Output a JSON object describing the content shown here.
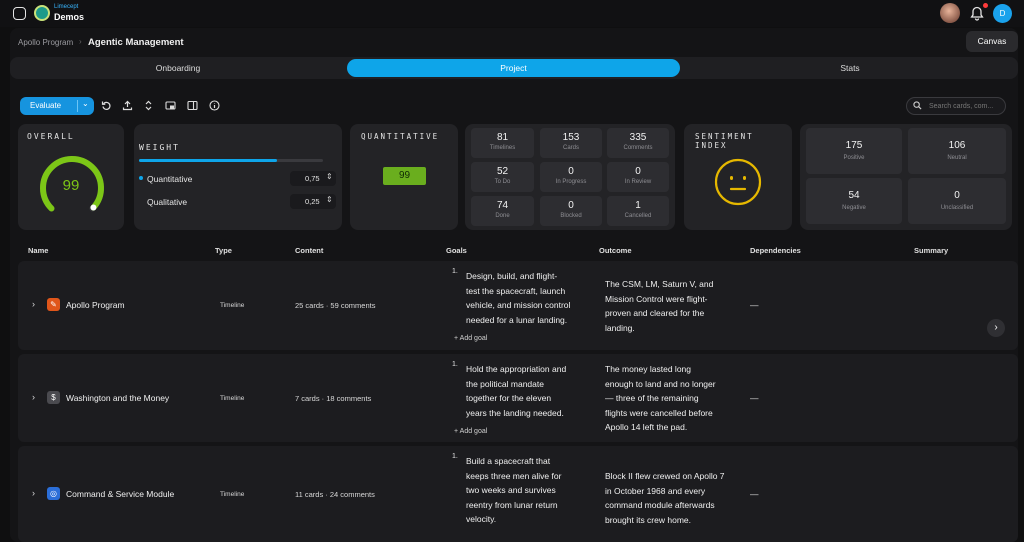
{
  "brand": {
    "sub": "Limecept",
    "name": "Demos"
  },
  "user": {
    "initial": "D"
  },
  "breadcrumb": {
    "parent": "Apollo Program",
    "current": "Agentic Management"
  },
  "canvas_label": "Canvas",
  "tabs": [
    {
      "label": "Onboarding"
    },
    {
      "label": "Project"
    },
    {
      "label": "Stats"
    }
  ],
  "toolbar": {
    "evaluate_label": "Evaluate",
    "search_placeholder": "Search cards, com..."
  },
  "overall": {
    "title": "OVERALL",
    "score": "99",
    "gauge_fraction": 0.99
  },
  "weight": {
    "title": "WEIGHT",
    "quantitative_fraction": 0.75,
    "quantitative_label": "Quantitative",
    "quantitative_value": "0,75",
    "qualitative_label": "Qualitative",
    "qualitative_value": "0,25"
  },
  "quantitative": {
    "title": "QUANTITATIVE",
    "score": "99"
  },
  "stats": [
    {
      "value": "81",
      "label": "Timelines"
    },
    {
      "value": "153",
      "label": "Cards"
    },
    {
      "value": "335",
      "label": "Comments"
    },
    {
      "value": "52",
      "label": "To Do"
    },
    {
      "value": "0",
      "label": "In Progress"
    },
    {
      "value": "0",
      "label": "In Review"
    },
    {
      "value": "74",
      "label": "Done"
    },
    {
      "value": "0",
      "label": "Blocked"
    },
    {
      "value": "1",
      "label": "Cancelled"
    }
  ],
  "sentiment": {
    "title": "SENTIMENT INDEX",
    "items": [
      {
        "value": "175",
        "label": "Positive"
      },
      {
        "value": "106",
        "label": "Neutral"
      },
      {
        "value": "54",
        "label": "Negative"
      },
      {
        "value": "0",
        "label": "Unclassified"
      }
    ]
  },
  "table": {
    "headers": {
      "name": "Name",
      "type": "Type",
      "content": "Content",
      "goals": "Goals",
      "outcome": "Outcome",
      "dependencies": "Dependencies",
      "summary": "Summary"
    },
    "add_goal_label": "+ Add goal",
    "rows": [
      {
        "name": "Apollo Program",
        "type": "Timeline",
        "content": "25 cards · 59 comments",
        "goal_num": "1.",
        "goal": [
          "Design, build, and flight-",
          "test the spacecraft, launch",
          "vehicle, and mission control",
          "needed for a lunar landing."
        ],
        "outcome": [
          "The CSM, LM, Saturn V, and",
          "Mission Control were flight-",
          "proven and cleared for the",
          "landing."
        ],
        "dependencies": "—"
      },
      {
        "name": "Washington and the Money",
        "type": "Timeline",
        "content": "7 cards · 18 comments",
        "goal_num": "1.",
        "goal": [
          "Hold the appropriation and",
          "the political mandate",
          "together for the eleven",
          "years the landing needed."
        ],
        "outcome": [
          "The money lasted long",
          "enough to land and no longer",
          "— three of the remaining",
          "flights were cancelled before",
          "Apollo 14 left the pad."
        ],
        "dependencies": "—"
      },
      {
        "name": "Command & Service Module",
        "type": "Timeline",
        "content": "11 cards · 24 comments",
        "goal_num": "1.",
        "goal": [
          "Build a spacecraft that",
          "keeps three men alive for",
          "two weeks and survives",
          "reentry from lunar return",
          "velocity."
        ],
        "outcome": [
          "Block II flew crewed on Apollo 7",
          "in October 1968 and every",
          "command module afterwards",
          "brought its crew home."
        ],
        "dependencies": "—"
      }
    ]
  },
  "colors": {
    "accent": "#0ea5e9",
    "score_green": "#7cc617",
    "sentiment_yellow": "#e6b800"
  }
}
